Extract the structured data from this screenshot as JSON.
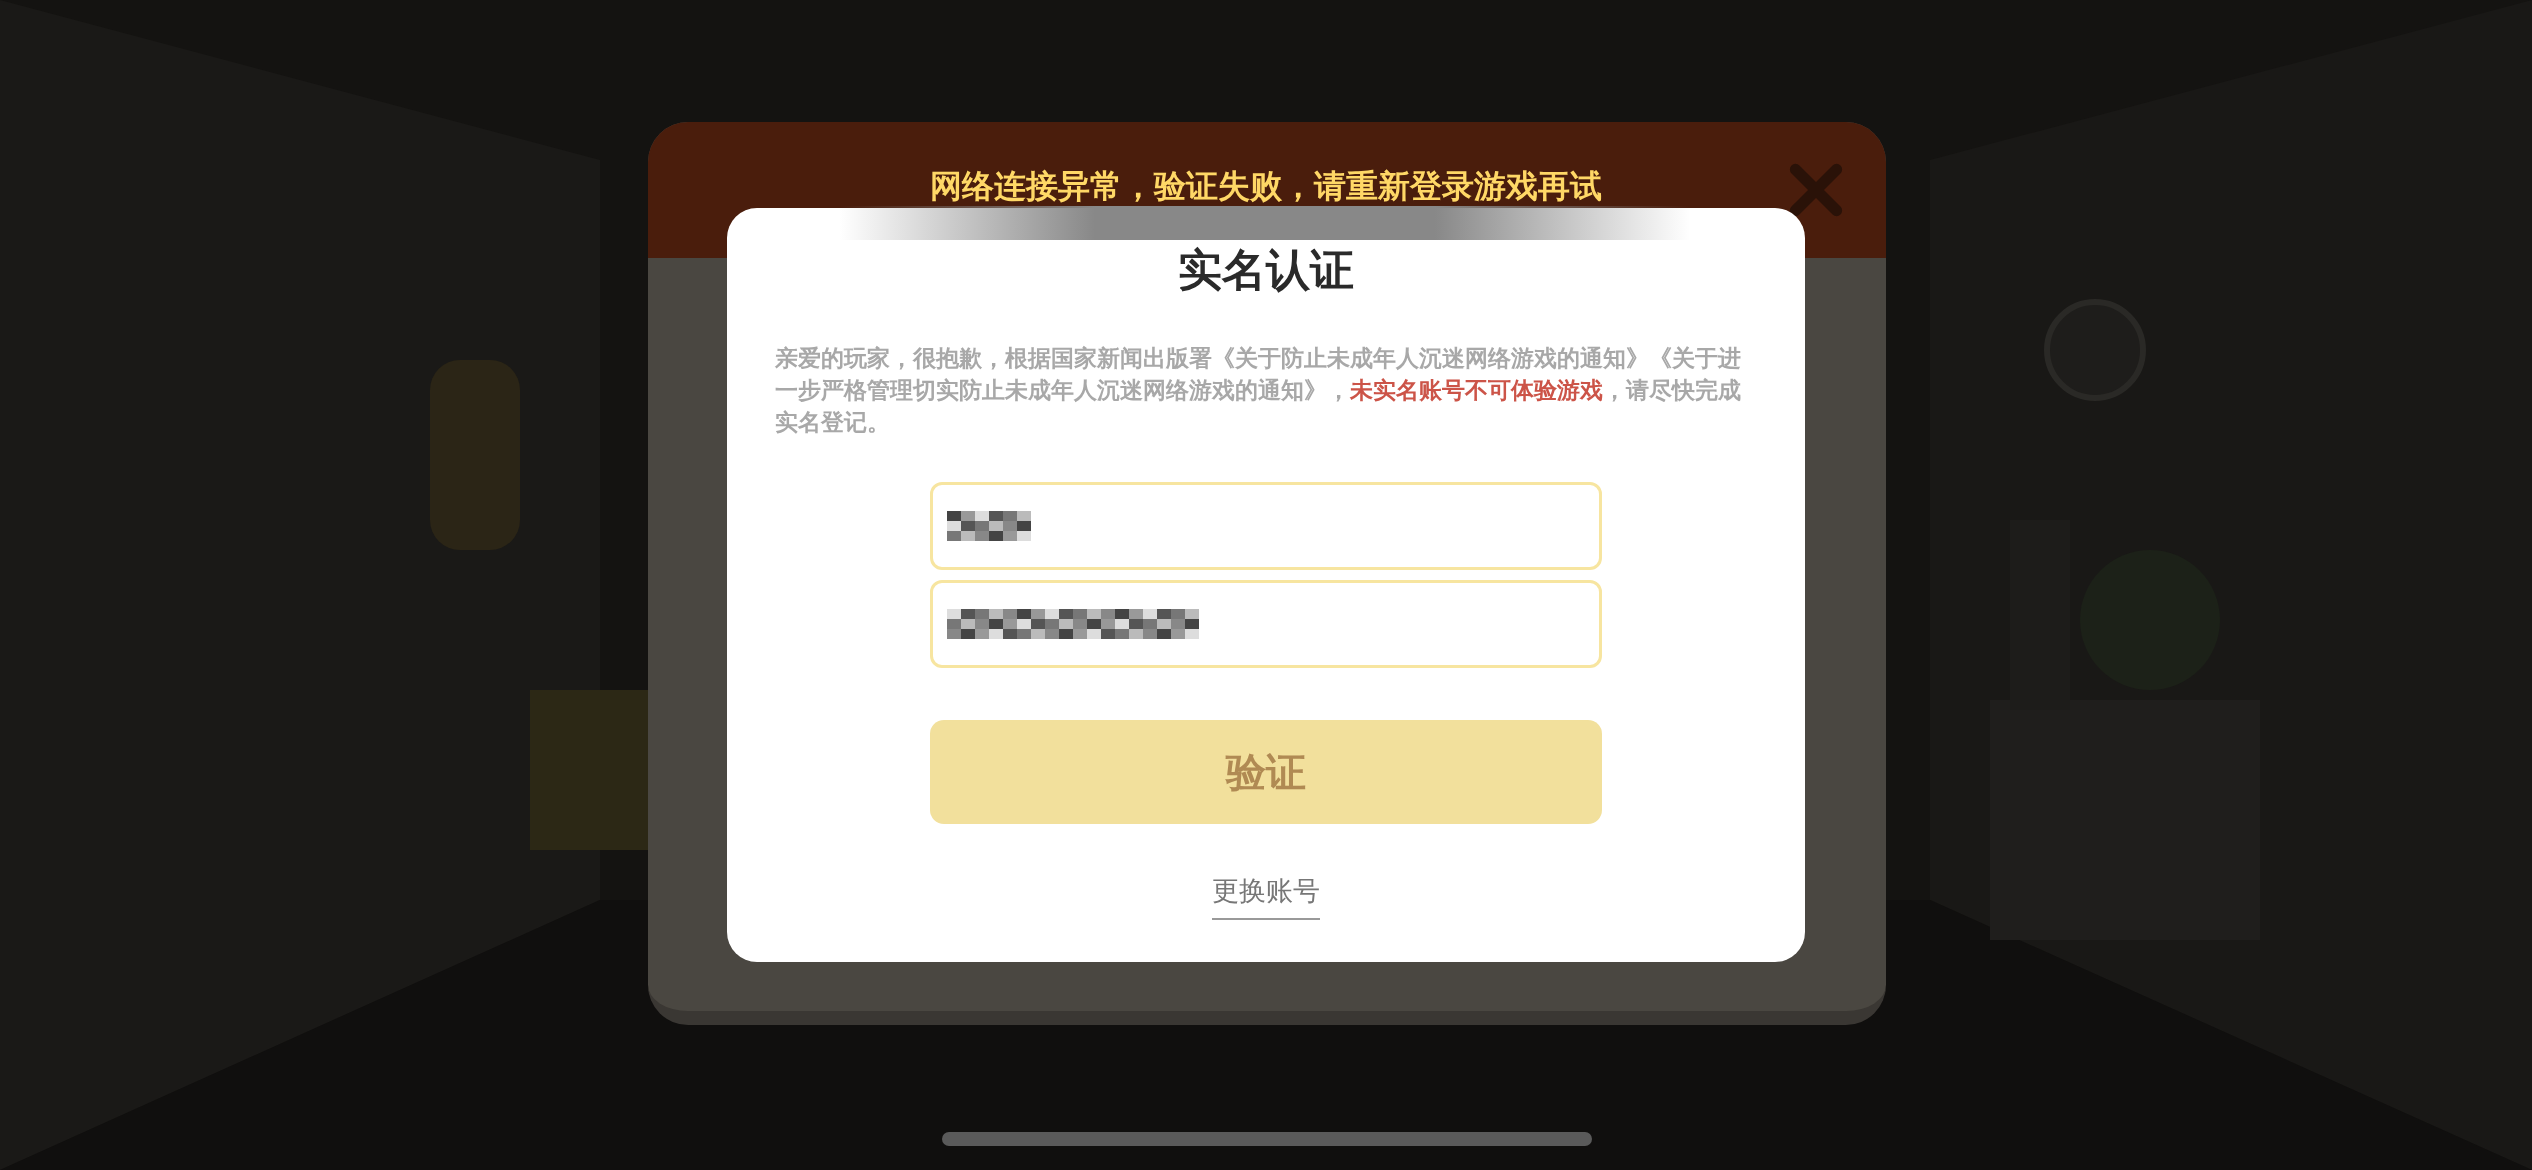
{
  "toast": {
    "text": "网络连接异常，验证失败，请重新登录游戏再试"
  },
  "dialog": {
    "title": "实名认证",
    "notice": "亲爱的玩家，很抱歉，根据国家新闻出版署《关于防止未成年人沉迷网络游戏的通知》《关于进一步严格管理切实防止未成年人沉迷网络游戏的通知》，**未实名账号不可体验游戏**，请尽快完成实名登记。",
    "fields": [
      {
        "kind": "name",
        "redacted": true
      },
      {
        "kind": "id",
        "redacted": true
      }
    ],
    "verify_button": "验证",
    "switch_account_link": "更换账号"
  }
}
